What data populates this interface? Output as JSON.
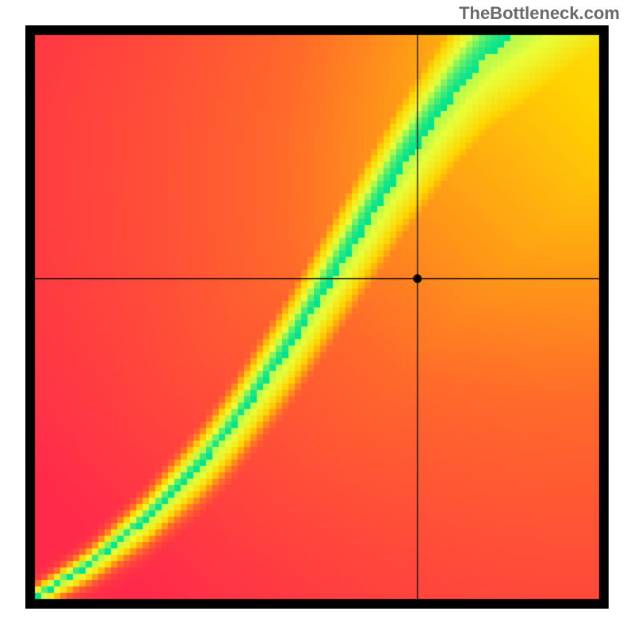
{
  "watermark": "TheBottleneck.com",
  "chart_data": {
    "type": "heatmap",
    "title": "",
    "xlabel": "",
    "ylabel": "",
    "xlim": [
      0,
      1
    ],
    "ylim": [
      0,
      1
    ],
    "grid": false,
    "legend": false,
    "crosshair": {
      "x": 0.678,
      "y": 0.568
    },
    "marker": {
      "x": 0.678,
      "y": 0.568
    },
    "colormap_stops": [
      {
        "t": 0.0,
        "color": "#ff2a4a"
      },
      {
        "t": 0.25,
        "color": "#ff6a2a"
      },
      {
        "t": 0.5,
        "color": "#ffd400"
      },
      {
        "t": 0.75,
        "color": "#e8ff3a"
      },
      {
        "t": 1.0,
        "color": "#00e38e"
      }
    ],
    "ridge": {
      "description": "Approximate centerline of the green optimal band (normalized y for given x, origin bottom-left)",
      "points": [
        {
          "x": 0.0,
          "y": 0.0
        },
        {
          "x": 0.05,
          "y": 0.03
        },
        {
          "x": 0.1,
          "y": 0.06
        },
        {
          "x": 0.15,
          "y": 0.1
        },
        {
          "x": 0.2,
          "y": 0.14
        },
        {
          "x": 0.25,
          "y": 0.19
        },
        {
          "x": 0.3,
          "y": 0.24
        },
        {
          "x": 0.35,
          "y": 0.3
        },
        {
          "x": 0.4,
          "y": 0.37
        },
        {
          "x": 0.45,
          "y": 0.44
        },
        {
          "x": 0.5,
          "y": 0.52
        },
        {
          "x": 0.55,
          "y": 0.6
        },
        {
          "x": 0.6,
          "y": 0.68
        },
        {
          "x": 0.65,
          "y": 0.76
        },
        {
          "x": 0.7,
          "y": 0.83
        },
        {
          "x": 0.75,
          "y": 0.9
        },
        {
          "x": 0.8,
          "y": 0.96
        },
        {
          "x": 0.85,
          "y": 1.0
        }
      ],
      "band_width_normalized": 0.06
    },
    "corner_values_estimate": {
      "top_left": 0.0,
      "top_right": 0.55,
      "bottom_left": 0.0,
      "bottom_right": 0.0,
      "along_ridge": 1.0
    }
  }
}
